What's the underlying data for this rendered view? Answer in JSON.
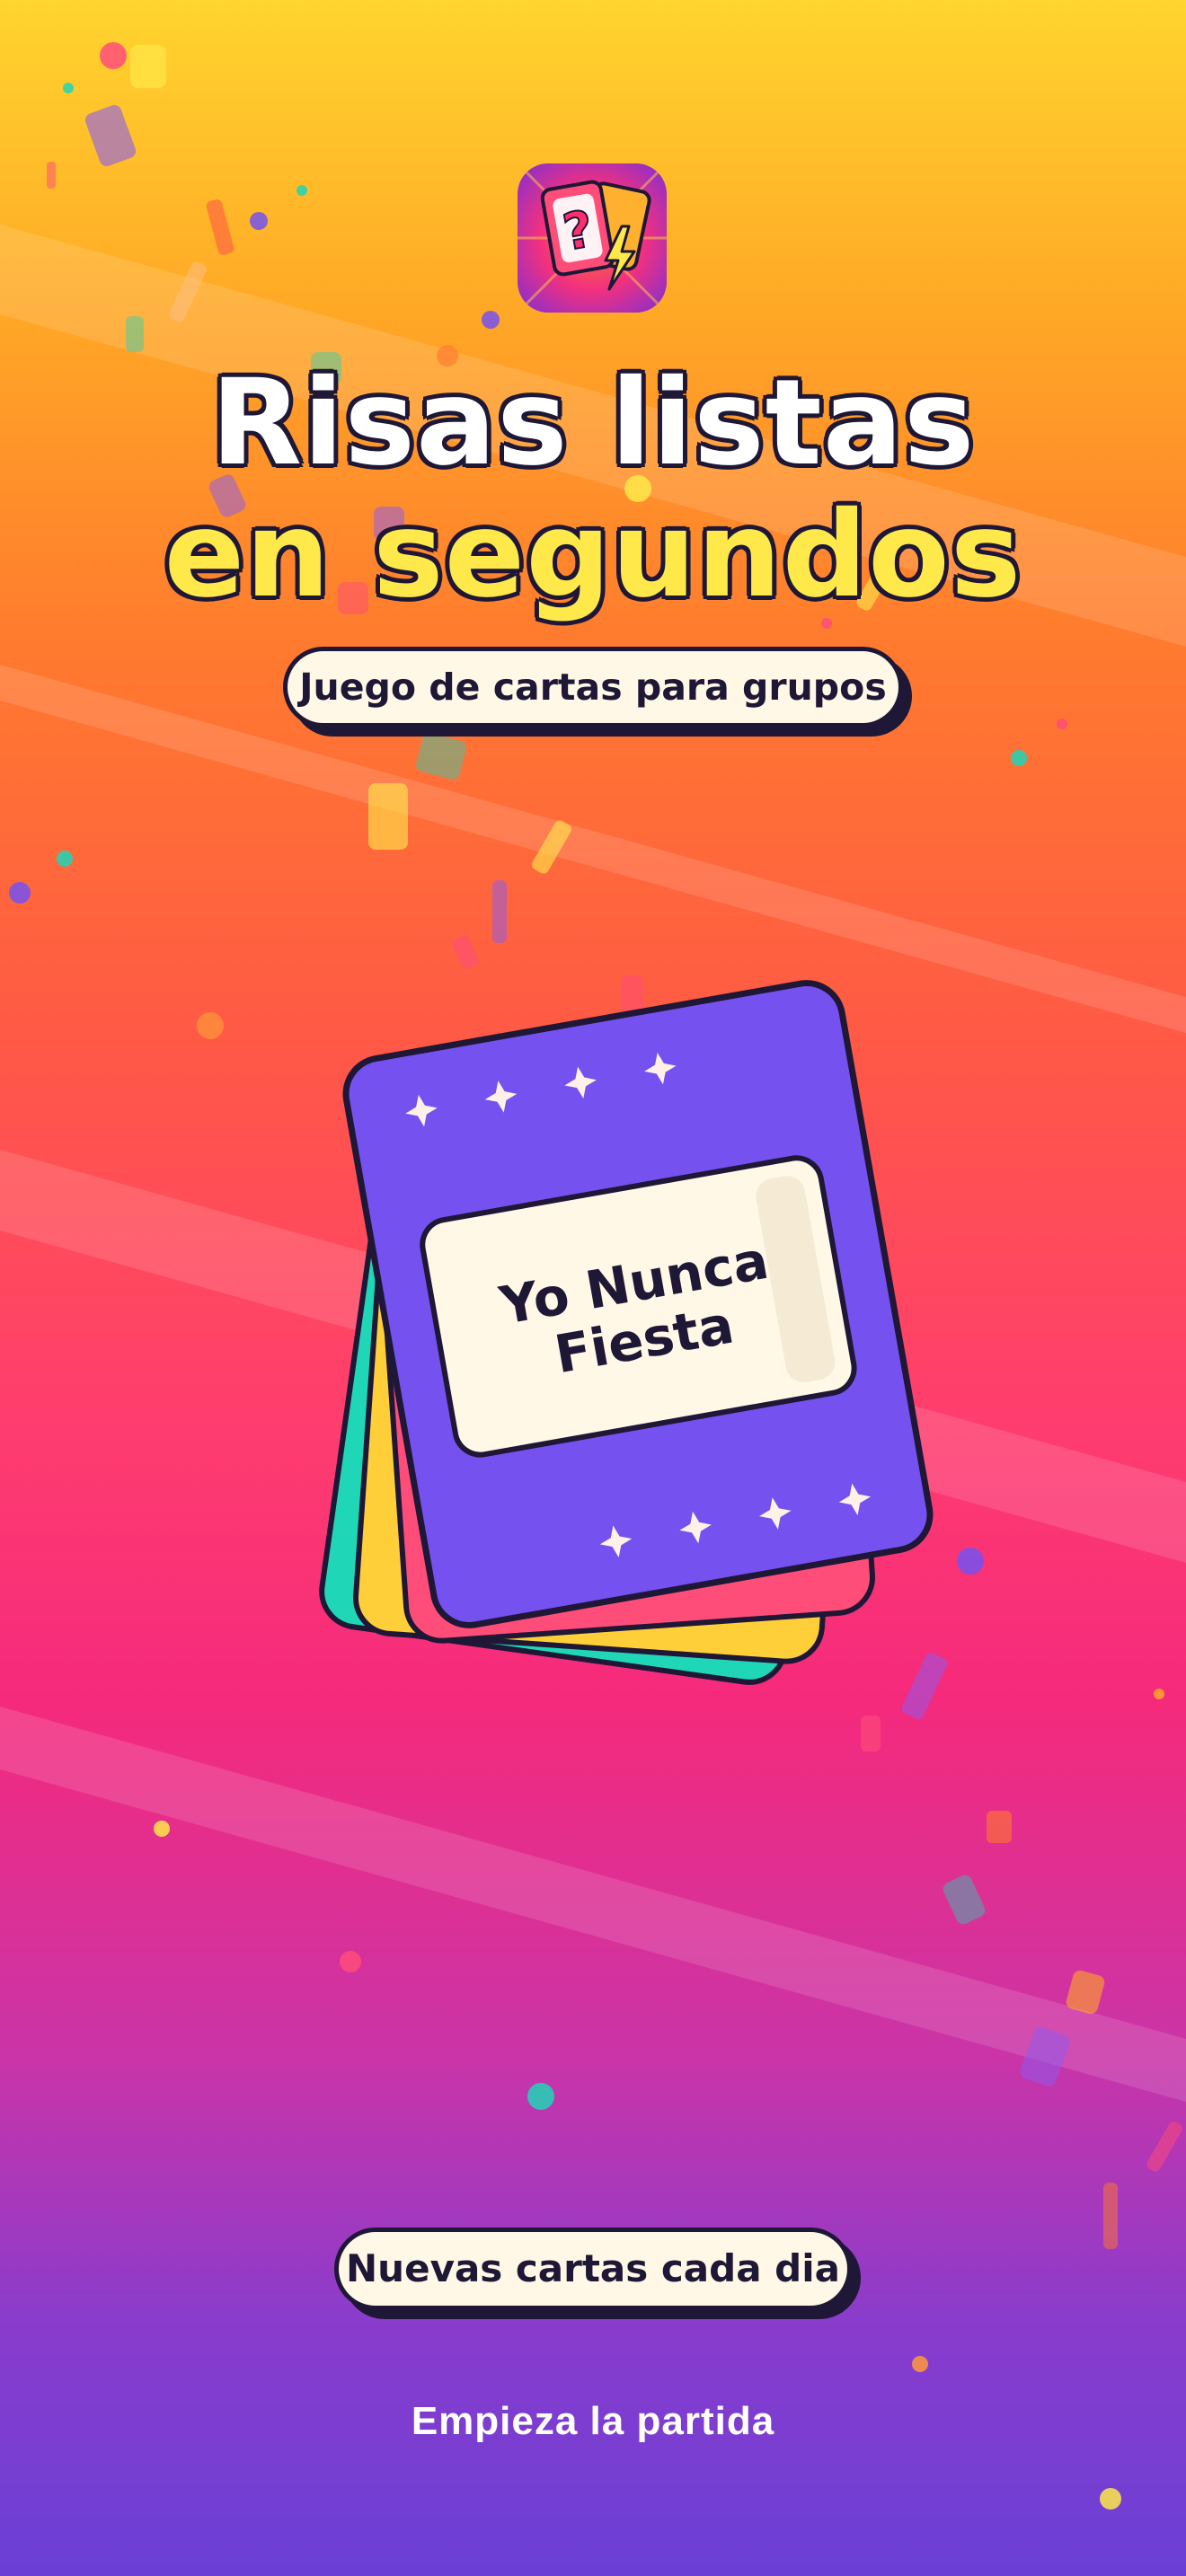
{
  "headline": {
    "line1": "Risas listas",
    "line2": "en segundos"
  },
  "subtitle_pill": "Juego de cartas para grupos",
  "card": {
    "title_line1": "Yo Nunca",
    "title_line2": "Fiesta"
  },
  "bottom_pill": "Nuevas cartas cada dia",
  "cta_label": "Empieza la partida",
  "app_icon": {
    "name": "question-card-lightning-icon",
    "question_mark": "?"
  },
  "colors": {
    "ink": "#1e1736",
    "card_purple": "#7552f0",
    "card_pink": "#ff4d7a",
    "card_yellow": "#ffcf3a",
    "card_teal": "#1fd6b7",
    "cream": "#fff8e6",
    "headline_yellow": "#ffe94a"
  }
}
